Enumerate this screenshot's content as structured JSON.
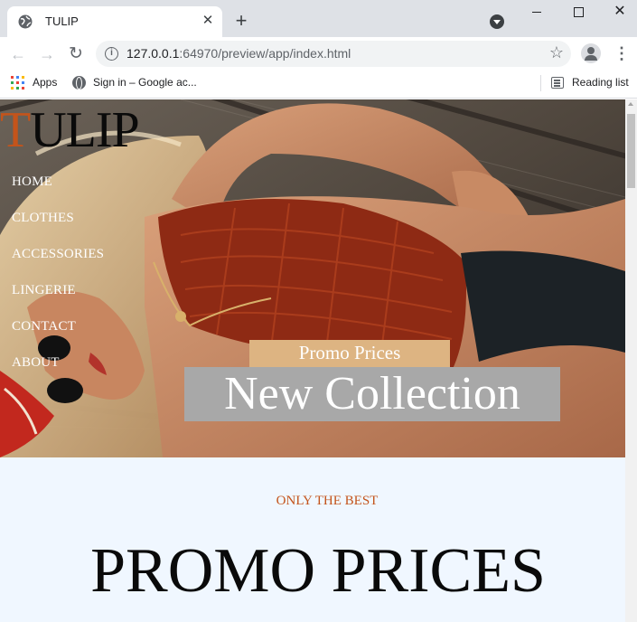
{
  "browser": {
    "tab_title": "TULIP",
    "url_host": "127.0.0.1",
    "url_rest": ":64970/preview/app/index.html",
    "bookmarks": [
      {
        "label": "Apps",
        "icon": "apps-grid-icon"
      },
      {
        "label": "Sign in – Google ac...",
        "icon": "globe-icon"
      }
    ],
    "reading_list": "Reading list"
  },
  "site": {
    "logo_first": "T",
    "logo_rest": "ULIP",
    "nav": [
      "HOME",
      "CLOTHES",
      "ACCESSORIES",
      "LINGERIE",
      "CONTACT",
      "ABOUT"
    ],
    "promo_tag": "Promo Prices",
    "collection": "New Collection",
    "subtitle": "ONLY THE BEST",
    "headline": "PROMO PRICES"
  },
  "colors": {
    "accent": "#c4541b",
    "promo_tag_bg": "#ddb482",
    "collection_bg": "#a8a8a8",
    "section_bg": "#f0f7ff"
  }
}
